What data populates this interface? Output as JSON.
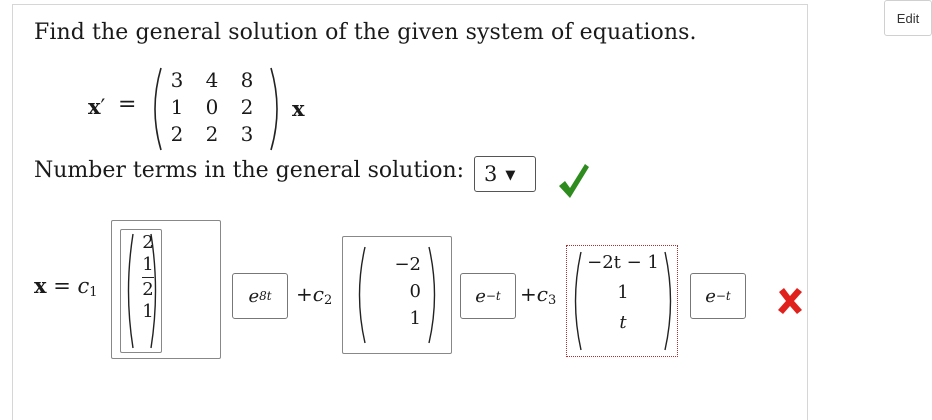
{
  "header": {
    "edit_label": "Edit"
  },
  "question": {
    "prompt": "Find the general solution of the given system of equations."
  },
  "equation": {
    "lhs": "x",
    "prime": "′",
    "equals": "=",
    "matrix": [
      [
        "3",
        "4",
        "8"
      ],
      [
        "1",
        "0",
        "2"
      ],
      [
        "2",
        "2",
        "3"
      ]
    ],
    "rhs_vector": "x"
  },
  "terms": {
    "label": "Number terms in the general solution:",
    "selected": "3",
    "status_icon": "check-icon",
    "status_color": "#2e8b1e"
  },
  "solution": {
    "x_eq": "x = c",
    "c1_sub": "1",
    "term1": {
      "vector": [
        "2",
        "1",
        "1",
        "2",
        "1"
      ],
      "exp_base": "e",
      "exp_power": "8t"
    },
    "plus_c2": "+c",
    "c2_sub": "2",
    "term2": {
      "vector": [
        "−2",
        "0",
        "1"
      ],
      "exp_base": "e",
      "exp_power": "−t"
    },
    "plus_c3": "+c",
    "c3_sub": "3",
    "term3": {
      "vector": [
        "−2t − 1",
        "1",
        "t"
      ],
      "exp_base": "e",
      "exp_power": "−t"
    },
    "status_icon": "x-mark-icon",
    "status_color": "#e0201c"
  }
}
